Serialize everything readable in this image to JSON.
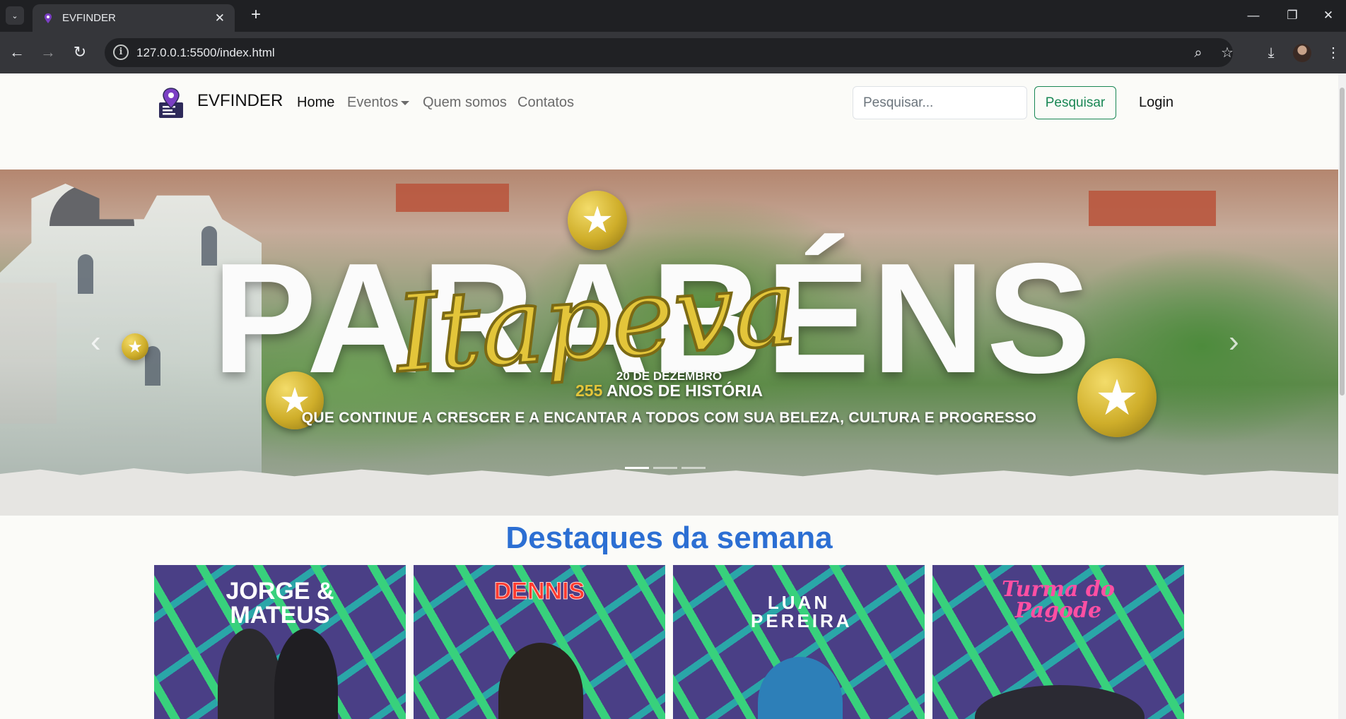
{
  "browser": {
    "tab_title": "EVFINDER",
    "url": "127.0.0.1:5500/index.html"
  },
  "navbar": {
    "brand": "EVFINDER",
    "links": [
      "Home",
      "Eventos",
      "Quem somos",
      "Contatos"
    ],
    "search_placeholder": "Pesquisar...",
    "search_button": "Pesquisar",
    "login": "Login"
  },
  "carousel": {
    "big_word": "PARABÉNS",
    "script_word": "Itapeva",
    "date": "20 DE DEZEMBRO",
    "years": "255",
    "history": "ANOS DE HISTÓRIA",
    "tagline": "QUE CONTINUE A CRESCER E A ENCANTAR A TODOS COM SUA BELEZA, CULTURA E PROGRESSO",
    "slides_count": 3,
    "active_slide": 0
  },
  "highlights": {
    "title": "Destaques da semana",
    "cards": [
      {
        "name": "JORGE & MATEUS",
        "color": "#ffffff"
      },
      {
        "name": "DENNIS",
        "color": "#ff3b30"
      },
      {
        "name": "LUAN PEREIRA",
        "color": "#ffffff"
      },
      {
        "name": "Turma do Pagode",
        "color": "#ff4fa3"
      }
    ]
  },
  "colors": {
    "link_active": "#111111",
    "link": "#6b6b6b",
    "success": "#198754",
    "section_title": "#2c6fd3"
  }
}
